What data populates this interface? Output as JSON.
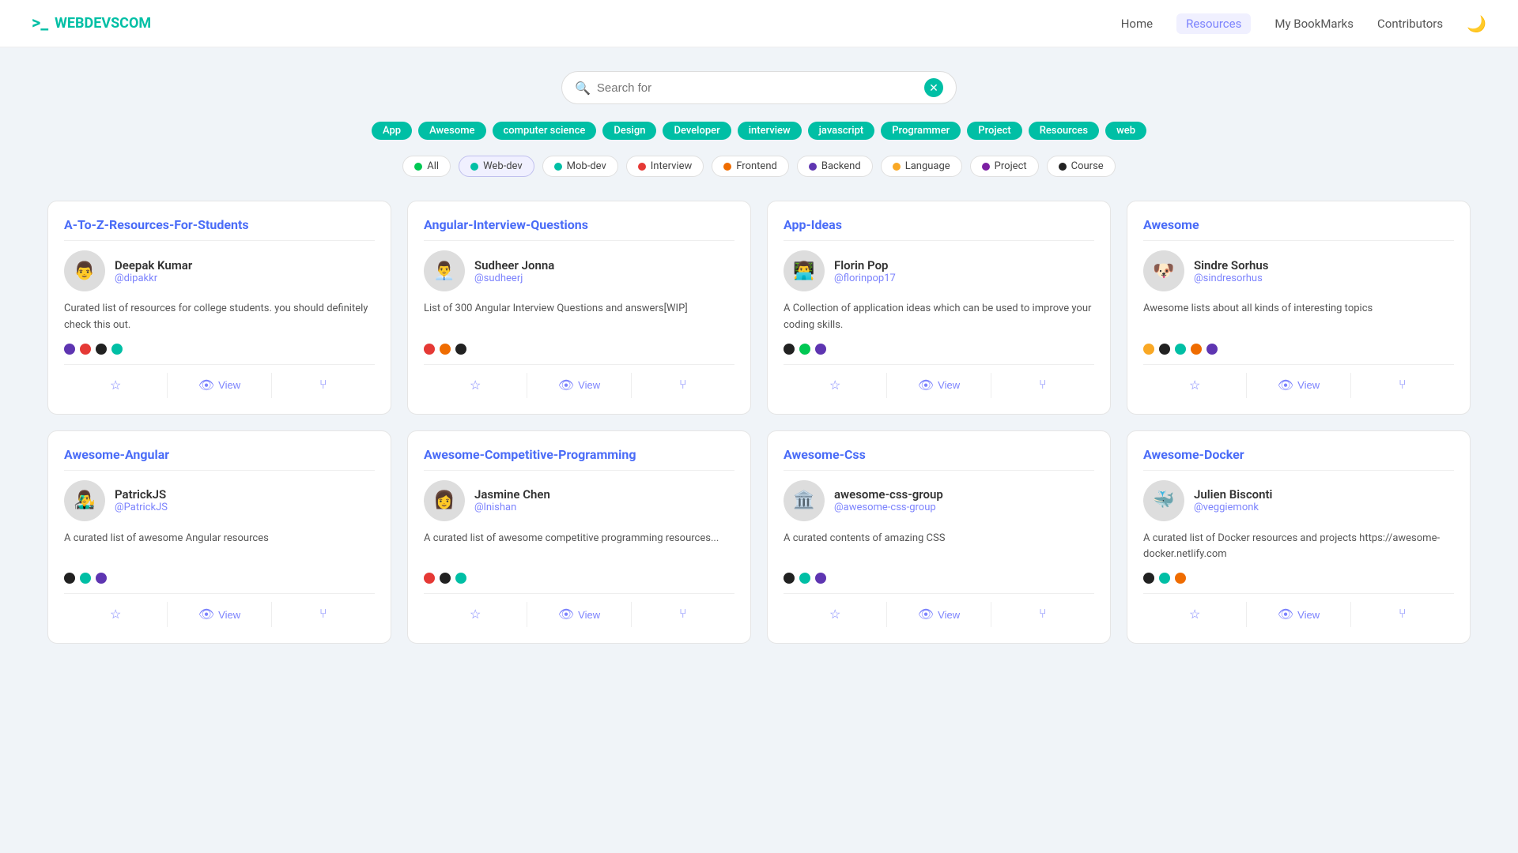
{
  "nav": {
    "logo": "WEBDEVSCOM",
    "links": [
      "Home",
      "Resources",
      "My BookMarks",
      "Contributors"
    ],
    "active_link": "Resources"
  },
  "search": {
    "placeholder": "Search for",
    "value": ""
  },
  "tags": [
    "App",
    "Awesome",
    "computer science",
    "Design",
    "Developer",
    "interview",
    "javascript",
    "Programmer",
    "Project",
    "Resources",
    "web"
  ],
  "filters": [
    {
      "label": "All",
      "color": "#00c853",
      "active": false
    },
    {
      "label": "Web-dev",
      "color": "#00bfa5",
      "active": true
    },
    {
      "label": "Mob-dev",
      "color": "#00bfa5",
      "active": false
    },
    {
      "label": "Interview",
      "color": "#e53935",
      "active": false
    },
    {
      "label": "Frontend",
      "color": "#ef6c00",
      "active": false
    },
    {
      "label": "Backend",
      "color": "#5e35b1",
      "active": false
    },
    {
      "label": "Language",
      "color": "#f9a825",
      "active": false
    },
    {
      "label": "Project",
      "color": "#7b1fa2",
      "active": false
    },
    {
      "label": "Course",
      "color": "#212121",
      "active": false
    }
  ],
  "cards": [
    {
      "title": "A-To-Z-Resources-For-Students",
      "author_name": "Deepak Kumar",
      "author_handle": "@dipakkr",
      "author_emoji": "👨",
      "description": "Curated list of resources for college students. you should definitely check this out.",
      "dots": [
        "#5e35b1",
        "#e53935",
        "#212121",
        "#00bfa5"
      ]
    },
    {
      "title": "Angular-Interview-Questions",
      "author_name": "Sudheer Jonna",
      "author_handle": "@sudheerj",
      "author_emoji": "👨‍💼",
      "description": "List of 300 Angular Interview Questions and answers[WIP]",
      "dots": [
        "#e53935",
        "#ef6c00",
        "#212121"
      ]
    },
    {
      "title": "App-Ideas",
      "author_name": "Florin Pop",
      "author_handle": "@florinpop17",
      "author_emoji": "👨‍💻",
      "description": "A Collection of application ideas which can be used to improve your coding skills.",
      "dots": [
        "#212121",
        "#00c853",
        "#5e35b1"
      ]
    },
    {
      "title": "Awesome",
      "author_name": "Sindre Sorhus",
      "author_handle": "@sindresorhus",
      "author_emoji": "🐶",
      "description": "Awesome lists about all kinds of interesting topics",
      "dots": [
        "#f9a825",
        "#212121",
        "#00bfa5",
        "#ef6c00",
        "#5e35b1"
      ]
    },
    {
      "title": "Awesome-Angular",
      "author_name": "PatrickJS",
      "author_handle": "@PatrickJS",
      "author_emoji": "👨‍🎤",
      "description": "A curated list of awesome Angular resources",
      "dots": [
        "#212121",
        "#00bfa5",
        "#5e35b1"
      ]
    },
    {
      "title": "Awesome-Competitive-Programming",
      "author_name": "Jasmine Chen",
      "author_handle": "@lnishan",
      "author_emoji": "👩",
      "description": "A curated list of awesome competitive programming resources...",
      "dots": [
        "#e53935",
        "#212121",
        "#00bfa5"
      ]
    },
    {
      "title": "Awesome-Css",
      "author_name": "awesome-css-group",
      "author_handle": "@awesome-css-group",
      "author_emoji": "🏛️",
      "description": "A curated contents of amazing CSS",
      "dots": [
        "#212121",
        "#00bfa5",
        "#5e35b1"
      ]
    },
    {
      "title": "Awesome-Docker",
      "author_name": "Julien Bisconti",
      "author_handle": "@veggiemonk",
      "author_emoji": "🐳",
      "description": "A curated list of Docker resources and projects https://awesome-docker.netlify.com",
      "dots": [
        "#212121",
        "#00bfa5",
        "#ef6c00"
      ]
    }
  ],
  "card_actions": {
    "bookmark": "☆",
    "view": "View",
    "fork": "⑂"
  }
}
